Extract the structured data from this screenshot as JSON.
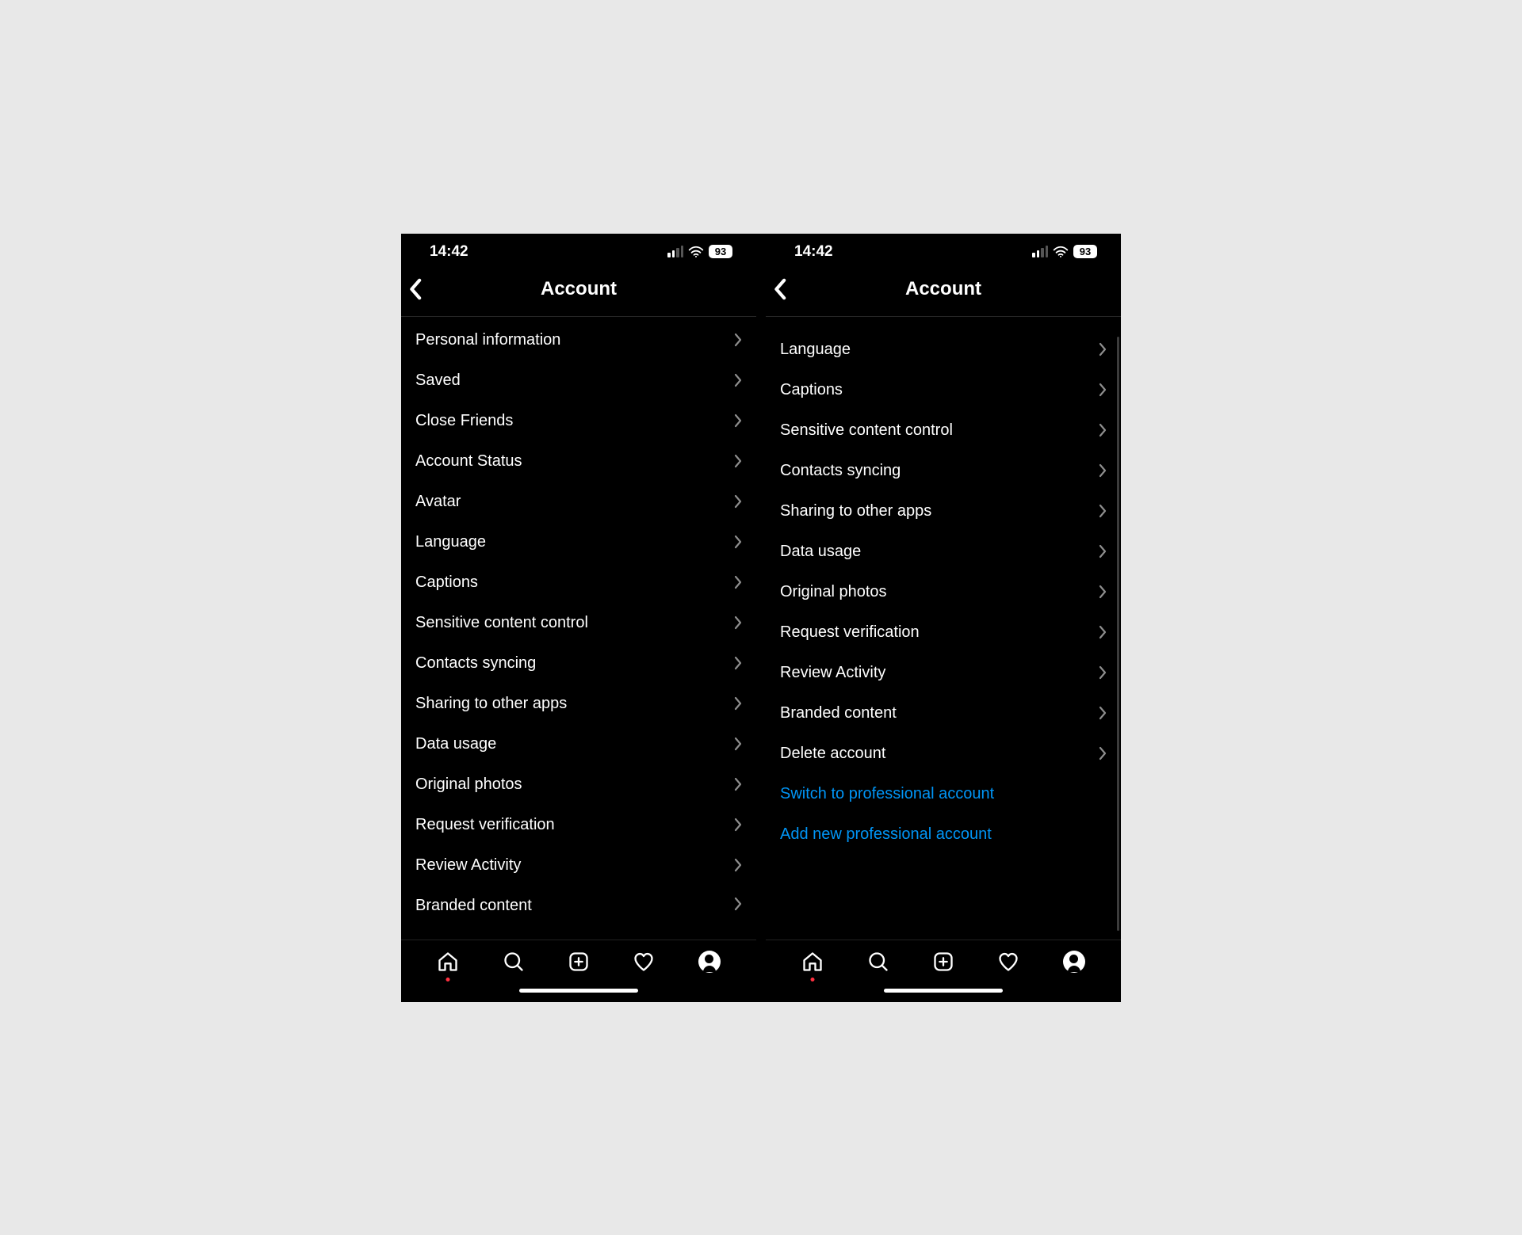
{
  "status": {
    "time": "14:42",
    "battery": "93"
  },
  "header": {
    "title": "Account"
  },
  "screenA": {
    "items": [
      {
        "label": "Personal information"
      },
      {
        "label": "Saved"
      },
      {
        "label": "Close Friends"
      },
      {
        "label": "Account Status"
      },
      {
        "label": "Avatar"
      },
      {
        "label": "Language"
      },
      {
        "label": "Captions"
      },
      {
        "label": "Sensitive content control"
      },
      {
        "label": "Contacts syncing"
      },
      {
        "label": "Sharing to other apps"
      },
      {
        "label": "Data usage"
      },
      {
        "label": "Original photos"
      },
      {
        "label": "Request verification"
      },
      {
        "label": "Review Activity"
      },
      {
        "label": "Branded content"
      }
    ]
  },
  "screenB": {
    "items": [
      {
        "label": "Language"
      },
      {
        "label": "Captions"
      },
      {
        "label": "Sensitive content control"
      },
      {
        "label": "Contacts syncing"
      },
      {
        "label": "Sharing to other apps"
      },
      {
        "label": "Data usage"
      },
      {
        "label": "Original photos"
      },
      {
        "label": "Request verification"
      },
      {
        "label": "Review Activity"
      },
      {
        "label": "Branded content"
      },
      {
        "label": "Delete account"
      }
    ],
    "links": [
      {
        "label": "Switch to professional account"
      },
      {
        "label": "Add new professional account"
      }
    ]
  }
}
